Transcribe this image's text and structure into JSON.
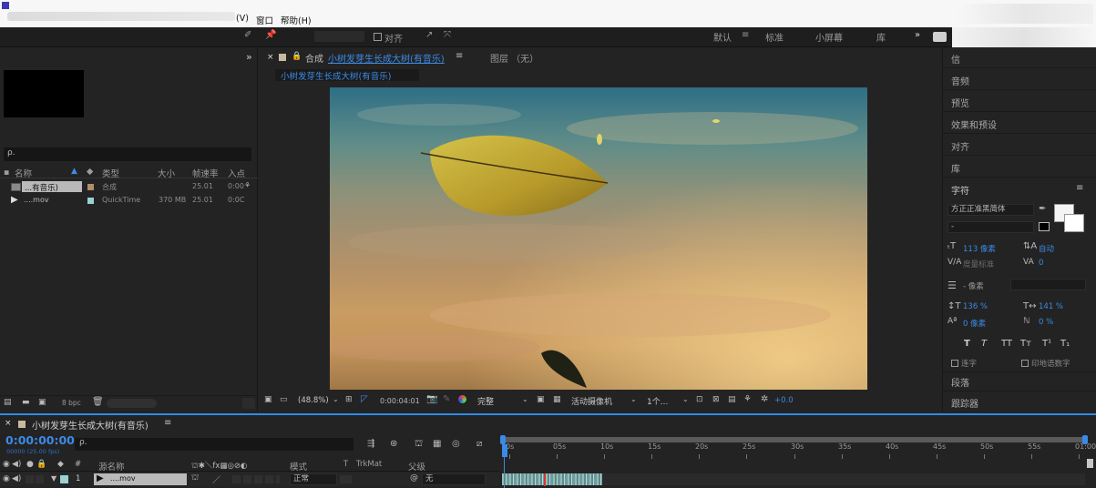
{
  "menubar": {
    "items": [
      "(V)",
      "窗口",
      "帮助(H)"
    ]
  },
  "toolbar": {
    "snap_label": "对齐",
    "workspaces": [
      "默认",
      "标准",
      "小屏幕",
      "库"
    ],
    "more": "»"
  },
  "project": {
    "collapse": "»",
    "search_icon": "ρ.",
    "columns": [
      "名称",
      "类型",
      "大小",
      "帧速率",
      "入点"
    ],
    "rows": [
      {
        "name": "...有音乐)",
        "type": "合成",
        "size": "",
        "fps": "25.01",
        "in": "0:00"
      },
      {
        "name": "....mov",
        "type": "QuickTime",
        "size": "370 MB",
        "fps": "25.01",
        "in": "0:0C"
      }
    ],
    "bpc": "8 bpc"
  },
  "composition": {
    "tab_prefix": "合成",
    "tab_name": "小树发芽生长成大树(有音乐)",
    "tab_menu": "≡",
    "layer_tab": "图层 （无）",
    "crumb": "小树发芽生长成大树(有音乐)"
  },
  "viewer_bar": {
    "zoom": "(48.8%)",
    "timecode": "0:00:04:01",
    "resolution": "完整",
    "camera": "活动摄像机",
    "views": "1个...",
    "exposure": "+0.0"
  },
  "panels": {
    "items": [
      "信",
      "音频",
      "预览",
      "效果和预设",
      "对齐",
      "库",
      "字符"
    ],
    "bottom": [
      "段落",
      "跟踪器"
    ]
  },
  "character": {
    "menu": "≡",
    "font": "方正正准黑简体",
    "style": "-",
    "size": "113 像素",
    "leading": "自动",
    "kerning": "度量标准",
    "tracking": "0",
    "stroke": "- 像素",
    "vscale": "136 %",
    "hscale": "141 %",
    "baseline": "0 像素",
    "tsume": "0 %",
    "styles": [
      "T",
      "T",
      "TT",
      "Tт",
      "T¹",
      "T₁"
    ],
    "ligature": "连字",
    "hindi": "印地语数字"
  },
  "timeline": {
    "tab_name": "小树发芽生长成大树(有音乐)",
    "tab_menu": "≡",
    "timecode": "0:00:00:00",
    "timecode_sub": "00000 (25.00 fps)",
    "search_icon": "ρ.",
    "col_source": "源名称",
    "col_mode": "模式",
    "col_t": "T",
    "col_trkmat": "TrkMat",
    "col_parent": "父级",
    "layer": {
      "num": "1",
      "name": "....mov",
      "mode": "正常",
      "parent": "无"
    },
    "ruler": [
      "0s",
      "05s",
      "10s",
      "15s",
      "20s",
      "25s",
      "30s",
      "35s",
      "40s",
      "45s",
      "50s",
      "55s",
      "01:00"
    ]
  },
  "colors": {
    "accent": "#2d8ceb",
    "bg": "#232323",
    "panel_dark": "#1e1e1e",
    "video_sky": "#2e6e86",
    "video_sunset": "#c89c62"
  }
}
